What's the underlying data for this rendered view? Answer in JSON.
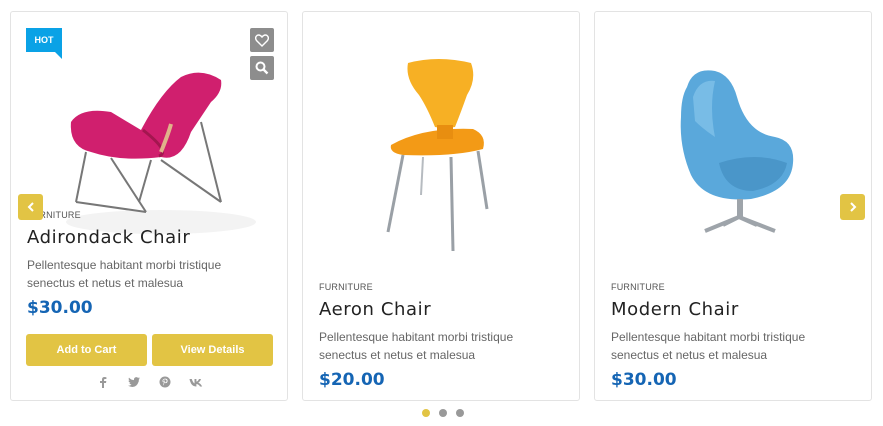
{
  "products": [
    {
      "category": "FURNITURE",
      "name": "Adirondack Chair",
      "description": "Pellentesque habitant morbi tristique senectus et netus et malesua",
      "price": "$30.00",
      "badge": "HOT",
      "add_to_cart_label": "Add to Cart",
      "view_details_label": "View Details"
    },
    {
      "category": "FURNITURE",
      "name": "Aeron Chair",
      "description": "Pellentesque habitant morbi tristique senectus et netus et malesua",
      "price": "$20.00"
    },
    {
      "category": "FURNITURE",
      "name": "Modern Chair",
      "description": "Pellentesque habitant morbi tristique senectus et netus et malesua",
      "price": "$30.00"
    }
  ],
  "icons": {
    "wishlist": "heart-icon",
    "quickview": "search-icon",
    "social": [
      "facebook-icon",
      "twitter-icon",
      "pinterest-icon",
      "vk-icon"
    ],
    "prev": "chevron-left-icon",
    "next": "chevron-right-icon"
  },
  "carousel": {
    "pages": 3,
    "active_page": 1
  },
  "colors": {
    "accent": "#e2c444",
    "price": "#1565b4",
    "badge": "#0aa2e6",
    "icon_bg": "#8d8d8d"
  }
}
